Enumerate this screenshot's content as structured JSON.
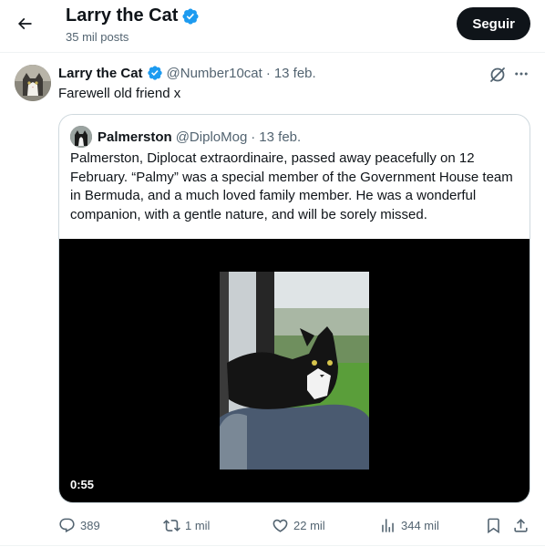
{
  "header": {
    "name": "Larry the Cat",
    "posts_count": "35 mil posts",
    "follow_label": "Seguir"
  },
  "tweet": {
    "author_name": "Larry the Cat",
    "author_handle": "@Number10cat",
    "separator": "·",
    "date": "13 feb.",
    "text": "Farewell old friend x",
    "quote": {
      "author_name": "Palmerston",
      "author_handle": "@DiploMog",
      "separator": "·",
      "date": "13 feb.",
      "text": "Palmerston, Diplocat extraordinaire, passed away peacefully on 12 February. “Palmy” was a special member of the Government House team in Bermuda, and a much loved family member. He was a wonderful companion, with a gentle nature, and will be sorely missed.",
      "video_duration": "0:55"
    },
    "actions": {
      "replies": "389",
      "reposts": "1 mil",
      "likes": "22 mil",
      "views": "344 mil"
    }
  },
  "colors": {
    "verified": "#1d9bf0",
    "text_primary": "#0f1419",
    "text_secondary": "#536471",
    "border": "#cfd9de"
  },
  "icons": [
    "back-arrow-icon",
    "verified-badge-icon",
    "grok-icon",
    "more-icon",
    "reply-icon",
    "repost-icon",
    "like-icon",
    "views-icon",
    "bookmark-icon",
    "share-icon"
  ]
}
